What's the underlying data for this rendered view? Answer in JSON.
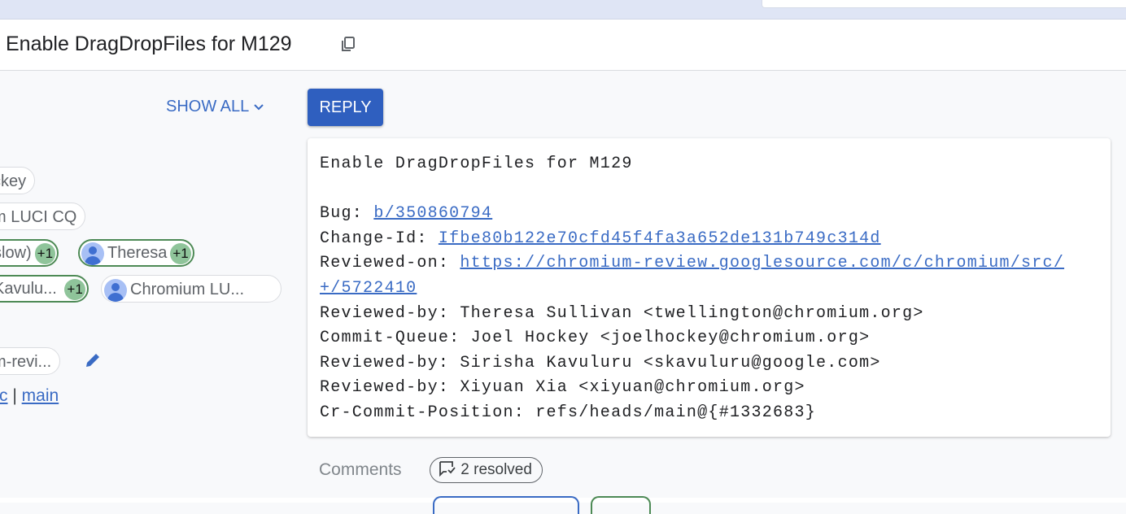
{
  "header": {
    "title": "Enable DragDropFiles for M129",
    "copy_icon": "copy-icon"
  },
  "sidebar": {
    "show_all": "SHOW ALL",
    "chips": [
      {
        "label": "ckey"
      },
      {
        "label": "m LUCI CQ"
      },
      {
        "label": "slow)",
        "vote": "+1"
      },
      {
        "label": "Theresa",
        "vote": "+1"
      },
      {
        "label": "Kavulu...",
        "vote": "+1"
      },
      {
        "label": "Chromium LU..."
      },
      {
        "label": "m-revi..."
      }
    ],
    "repo_link": "rc",
    "separator": "|",
    "branch_link": "main"
  },
  "actions": {
    "reply": "REPLY"
  },
  "commit": {
    "subject": "Enable DragDropFiles for M129",
    "bug_label": "Bug: ",
    "bug": "b/350860794",
    "changeid_label": "Change-Id: ",
    "changeid": "Ifbe80b122e70cfd45f4fa3a652de131b749c314d",
    "reviewedon_label": "Reviewed-on: ",
    "reviewedon_1": "https://chromium-review.googlesource.com/c/chromium/src/",
    "reviewedon_2": "+/5722410",
    "trailers": [
      "Reviewed-by: Theresa Sullivan <twellington@chromium.org>",
      "Commit-Queue: Joel Hockey <joelhockey@chromium.org>",
      "Reviewed-by: Sirisha Kavuluru <skavuluru@google.com>",
      "Reviewed-by: Xiyuan Xia <xiyuan@chromium.org>",
      "Cr-Commit-Position: refs/heads/main@{#1332683}"
    ]
  },
  "comments": {
    "label": "Comments",
    "resolved": "2 resolved"
  },
  "colors": {
    "accent": "#2f5fbf",
    "vote": "#8fc49a",
    "approved_border": "#4d8a55"
  }
}
